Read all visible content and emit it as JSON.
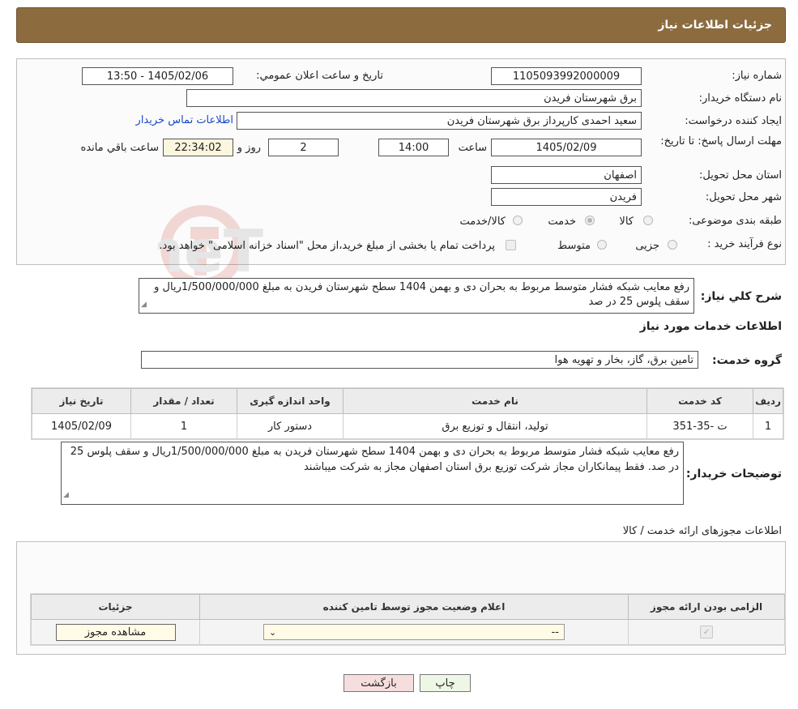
{
  "header": {
    "title": "جزئیات اطلاعات نیاز"
  },
  "form": {
    "need_number_label": "شماره نیاز:",
    "need_number": "1105093992000009",
    "announce_label": "تاریخ و ساعت اعلان عمومي:",
    "announce_value": "1405/02/06 - 13:50",
    "buyer_org_label": "نام دستگاه خريدار:",
    "buyer_org": "برق شهرستان فریدن",
    "creator_label": "ايجاد كننده درخواست:",
    "creator": "سعید احمدی کارپرداز برق شهرستان فریدن",
    "contact_link": "اطلاعات تماس خريدار",
    "deadline_label": "مهلت ارسال پاسخ: تا تاریخ:",
    "deadline_date": "1405/02/09",
    "time_label": "ساعت",
    "deadline_time": "14:00",
    "days_value": "2",
    "days_label": "روز و",
    "remaining_time": "22:34:02",
    "remaining_label": "ساعت باقي مانده",
    "province_label": "استان محل تحویل:",
    "province": "اصفهان",
    "city_label": "شهر محل تحویل:",
    "city": "فریدن",
    "category_label": "طبقه بندی موضوعی:",
    "category_options": [
      "کالا",
      "خدمت",
      "کالا/خدمت"
    ],
    "category_selected": "خدمت",
    "process_label": "نوع فرآيند خريد :",
    "process_options": [
      "جزیی",
      "متوسط"
    ],
    "process_note": "پرداخت تمام یا بخشی از مبلغ خرید،از محل \"اسناد خزانه اسلامی\" خواهد بود."
  },
  "summary": {
    "label": "شرح كلي نياز:",
    "text": "رفع معایب شبکه فشار متوسط مربوط به بحران دی و بهمن 1404 سطح شهرستان فریدن به مبلغ 1/500/000/000ریال و سقف پلوس 25 در صد"
  },
  "services": {
    "section_title": "اطلاعات خدمات مورد نياز",
    "group_label": "گروه خدمت:",
    "group_value": "تامین برق، گاز، بخار و تهویه هوا",
    "table": {
      "headers": [
        "ردیف",
        "کد خدمت",
        "نام خدمت",
        "واحد اندازه گیری",
        "تعداد / مقدار",
        "تاریخ نیاز"
      ],
      "rows": [
        [
          "1",
          "ت -35-351",
          "تولید، انتقال و توزیع برق",
          "دستور کار",
          "1",
          "1405/02/09"
        ]
      ]
    }
  },
  "buyer_notes": {
    "label": "توضيحات خريدار:",
    "text": "رفع معایب شبکه فشار متوسط مربوط به بحران دی و بهمن 1404 سطح شهرستان فریدن به مبلغ 1/500/000/000ریال و سقف پلوس 25 در صد. فقط پیمانکاران مجاز شرکت توزیع برق استان اصفهان مجاز به شرکت میباشند"
  },
  "permits": {
    "section_title": "اطلاعات مجوزهای ارائه خدمت / کالا",
    "headers": [
      "الزامی بودن ارائه مجوز",
      "اعلام وضعیت مجوز توسط تامین کننده",
      "جزئیات"
    ],
    "status_value": "--",
    "view_button": "مشاهده مجوز"
  },
  "actions": {
    "print": "چاپ",
    "back": "بازگشت"
  },
  "watermark": {
    "text": "AriaTender.neT"
  },
  "colors": {
    "header_bg": "#8c6c3f",
    "link": "#1a49c8",
    "back_button_bg": "#f7dede",
    "print_button_bg": "#eef7e6"
  }
}
